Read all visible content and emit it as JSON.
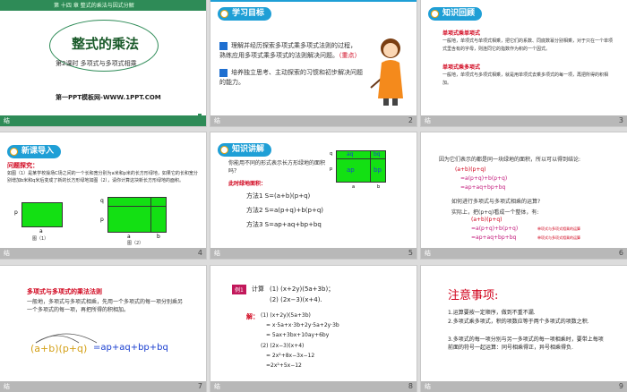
{
  "slides": [
    {
      "num": "1",
      "top_banner": "第 十四 章  整式的乘法与因式分解",
      "title": "整式的乘法",
      "subtitle": "第2课时  多项式与多项式相乘",
      "site": "第一PPT模板网-WWW.1PPT.COM",
      "footer": "结"
    },
    {
      "num": "2",
      "heading": "学习目标",
      "goal1": "理解并经历探索多项式乘多项式法则的过程，  熟练应用多项式乘多项式的法则解决问题。",
      "goal1_key": "（重点）",
      "goal2": "培养独立思考、主动探索的习惯和初步解决问题的能力。",
      "footer": "结"
    },
    {
      "num": "3",
      "heading": "知识回顾",
      "h1": "单项式乘单项式",
      "p1": "一般地，单项式与单项式相乘，把它们的系数、同底数幂分别相乘，对于只在一个单项式里含有的字母，则连同它的指数作为积的一个因式。",
      "h2": "单项式乘多项式",
      "p2": "一般地，单项式与多项式相乘，就是用单项式去乘多项式的每一项，再把所得的积相加。",
      "footer": "结"
    },
    {
      "num": "4",
      "heading": "新课导入",
      "q": "问题探究：",
      "text": "如图（1）是某学校操场C场之间的一个长和宽分别为a米和p米的长方形绿地，如果它的长和宽分别增加b米和q米后变成了新的长方形绿地如图（2），请你计算这块新长方形绿地的面积。",
      "fig1": "图（1）",
      "fig2": "图（2）",
      "lbl_p": "p",
      "lbl_q": "q",
      "lbl_a": "a",
      "lbl_b": "b",
      "footer": "结"
    },
    {
      "num": "5",
      "heading": "知识讲解",
      "question": "你能用不同的形式表示长方形绿地的面积吗？",
      "m_title": "此时绿地面积：",
      "m1": "方法1 S=(a+b)(p+q)",
      "m2": "方法2 S=a(p+q)+b(p+q)",
      "m3": "方法3 S=ap+aq+bp+bq",
      "cell_aq": "aq",
      "cell_bq": "bq",
      "cell_ap": "ap",
      "cell_bp": "bp",
      "lbl_a": "a",
      "lbl_b": "b",
      "lbl_p": "p",
      "lbl_q": "q",
      "footer": "结"
    },
    {
      "num": "6",
      "l1": "因为它们表示的都是同一块绿地的面积，所以可以得到结论:",
      "e1": "(a+b)(p+q)",
      "e2": "=a(p+q)+b(p+q)",
      "e3": "=ap+aq+bp+bq",
      "l2": "如何进行多项式与多项式相乘的运算?",
      "l3": "实际上，把(p+q)看成一个整体，有:",
      "e4": "(a+b)(p+q)",
      "e5": "=a(p+q)+b(p+q)",
      "e5_note": "单项式与多项式相乘的运算",
      "e6": "=ap+aq+bp+bq",
      "e6_note": "单项式与多项式相乘的运算",
      "footer": "结"
    },
    {
      "num": "7",
      "rule_title": "多项式与多项式的乘法法则",
      "rule_text": "一般地，多项式与多项式相乘，先用一个多项式的每一项分别乘另一个多项式的每一项，再把所得的积相加。",
      "formula_left": "(a+b)(p+q)",
      "formula_right": "=ap+aq+bp+bq",
      "footer": "结"
    },
    {
      "num": "8",
      "tag": "例1",
      "prompt": "计算",
      "q1": "(1)  (x+2y)(5a+3b)；",
      "q2": "(2)  (2x−3)(x+4).",
      "sol_label": "解：",
      "s1": "(1) (x+2y)(5a+3b)",
      "s2": "= x·5a+x·3b+2y·5a+2y·3b",
      "s3": "= 5ax+3bx+10ay+6by",
      "s4": "(2) (2x−3)(x+4)",
      "s5": "= 2x²+8x−3x−12",
      "s6": "=2x²+5x−12",
      "footer": "结"
    },
    {
      "num": "9",
      "title": "注意事项:",
      "n1": "1.运算要按一定顺序，做到不重不漏.",
      "n2": "2.多项式乘多项式，积的项数应等于两个多项式的项数之积.",
      "n3": "3.多项式的每一项分别与另一多项式的每一项相乘时，要带上每项前面的符号一起运算：同号相乘得正，异号相乘得负.",
      "footer": "结"
    }
  ],
  "colors": {
    "accent_green": "#2e8b57",
    "pill_blue": "#1f9fd6",
    "grass_green": "#13e013",
    "red": "#d0021b",
    "blue": "#1a3fd0"
  }
}
